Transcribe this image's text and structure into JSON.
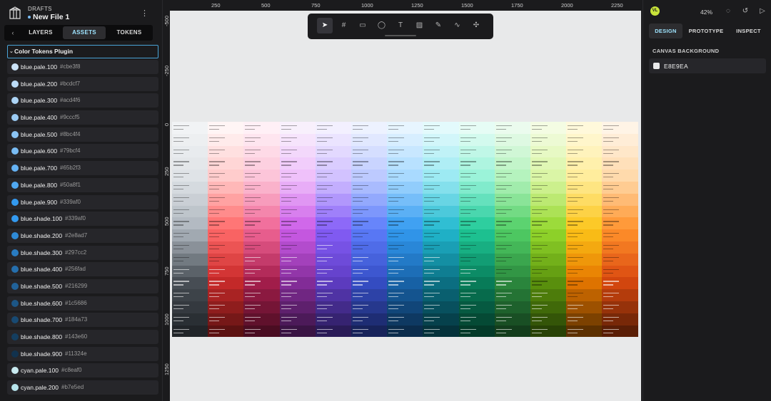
{
  "project": {
    "section": "DRAFTS",
    "file_name": "New File 1"
  },
  "left_tabs": [
    {
      "label": "LAYERS"
    },
    {
      "label": "ASSETS",
      "active": true
    },
    {
      "label": "TOKENS"
    }
  ],
  "plugin_group": "Color Tokens Plugin",
  "tokens": [
    {
      "name": "blue.pale.100",
      "hex": "#cbe3f8"
    },
    {
      "name": "blue.pale.200",
      "hex": "#bcdcf7"
    },
    {
      "name": "blue.pale.300",
      "hex": "#acd4f6"
    },
    {
      "name": "blue.pale.400",
      "hex": "#9cccf5"
    },
    {
      "name": "blue.pale.500",
      "hex": "#8bc4f4"
    },
    {
      "name": "blue.pale.600",
      "hex": "#79bcf4"
    },
    {
      "name": "blue.pale.700",
      "hex": "#65b2f3"
    },
    {
      "name": "blue.pale.800",
      "hex": "#50a8f1"
    },
    {
      "name": "blue.pale.900",
      "hex": "#339af0"
    },
    {
      "name": "blue.shade.100",
      "hex": "#339af0"
    },
    {
      "name": "blue.shade.200",
      "hex": "#2e8ad7"
    },
    {
      "name": "blue.shade.300",
      "hex": "#297cc2"
    },
    {
      "name": "blue.shade.400",
      "hex": "#256fad"
    },
    {
      "name": "blue.shade.500",
      "hex": "#216299"
    },
    {
      "name": "blue.shade.600",
      "hex": "#1c5686"
    },
    {
      "name": "blue.shade.700",
      "hex": "#184a73"
    },
    {
      "name": "blue.shade.800",
      "hex": "#143e60"
    },
    {
      "name": "blue.shade.900",
      "hex": "#11324e"
    },
    {
      "name": "cyan.pale.100",
      "hex": "#c8eaf0"
    },
    {
      "name": "cyan.pale.200",
      "hex": "#b7e5ed"
    }
  ],
  "rulers": {
    "top": [
      "250",
      "500",
      "750",
      "1000",
      "1250",
      "1500",
      "1750",
      "2000",
      "2250"
    ],
    "left": [
      "-500",
      "-250",
      "0",
      "250",
      "500",
      "750",
      "1000",
      "1250"
    ]
  },
  "toolbar": {
    "tools": [
      {
        "icon": "pointer-icon",
        "glyph": "➤",
        "active": true
      },
      {
        "icon": "board-icon",
        "glyph": "#"
      },
      {
        "icon": "rectangle-icon",
        "glyph": "▭"
      },
      {
        "icon": "ellipse-icon",
        "glyph": "◯"
      },
      {
        "icon": "text-icon",
        "glyph": "T"
      },
      {
        "icon": "image-icon",
        "glyph": "▨"
      },
      {
        "icon": "pencil-icon",
        "glyph": "✎"
      },
      {
        "icon": "path-icon",
        "glyph": "∿"
      },
      {
        "icon": "plugin-icon",
        "glyph": "✣"
      }
    ]
  },
  "board_palettes": [
    [
      "#f1f3f5",
      "#dee2e6",
      "#adb5bd",
      "#495057",
      "#212529"
    ],
    [
      "#fff5f5",
      "#ffc9c9",
      "#ff6b6b",
      "#c92a2a",
      "#5c1212"
    ],
    [
      "#fff0f6",
      "#fcc2d7",
      "#f06595",
      "#a61e4d",
      "#4a0d22"
    ],
    [
      "#f8f0fc",
      "#eebefa",
      "#cc5de8",
      "#862e9c",
      "#3a1444"
    ],
    [
      "#f3f0ff",
      "#d0bfff",
      "#845ef7",
      "#5f3dc4",
      "#2a1b57"
    ],
    [
      "#edf2ff",
      "#bac8ff",
      "#5c7cfa",
      "#364fc7",
      "#17235a"
    ],
    [
      "#e7f5ff",
      "#a5d8ff",
      "#339af0",
      "#1864ab",
      "#0b2c4c"
    ],
    [
      "#e3fafc",
      "#99e9f2",
      "#22b8cf",
      "#0b7285",
      "#05323b"
    ],
    [
      "#e6fcf5",
      "#96f2d7",
      "#20c997",
      "#087f5b",
      "#043a29"
    ],
    [
      "#ebfbee",
      "#b2f2bb",
      "#51cf66",
      "#2b8a3e",
      "#133d1c"
    ],
    [
      "#f4fce3",
      "#d8f5a2",
      "#94d82d",
      "#5c940d",
      "#284206"
    ],
    [
      "#fff9db",
      "#ffec99",
      "#fcc419",
      "#e67700",
      "#5c3000"
    ],
    [
      "#fff4e6",
      "#ffd8a8",
      "#ff922b",
      "#d9480f",
      "#5a1e06"
    ]
  ],
  "right": {
    "avatar": "VL",
    "zoom": "42%",
    "tabs": [
      {
        "label": "DESIGN",
        "active": true
      },
      {
        "label": "PROTOTYPE"
      },
      {
        "label": "INSPECT"
      }
    ],
    "section_title": "CANVAS BACKGROUND",
    "canvas_bg": "E8E9EA"
  }
}
